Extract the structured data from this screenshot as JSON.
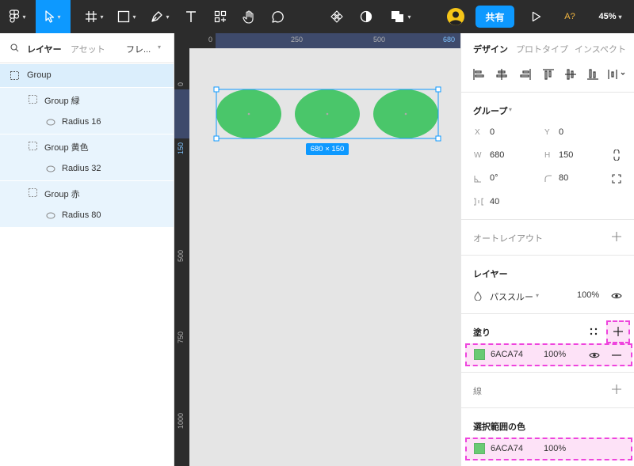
{
  "toolbar": {
    "share_label": "共有",
    "zoom_label": "45%",
    "font_check_label": "A?"
  },
  "left_panel": {
    "tabs": {
      "layers": "レイヤー",
      "assets": "アセット",
      "frame": "フレ..."
    },
    "layers": [
      {
        "label": "Group"
      },
      {
        "label": "Group 緑"
      },
      {
        "label": "Radius 16"
      },
      {
        "label": "Group 黄色"
      },
      {
        "label": "Radius 32"
      },
      {
        "label": "Group 赤"
      },
      {
        "label": "Radius 80"
      }
    ]
  },
  "ruler": {
    "top_ticks": [
      "0",
      "250",
      "500",
      "680"
    ],
    "left_ticks": [
      "0",
      "150",
      "500",
      "750",
      "1000"
    ]
  },
  "canvas": {
    "selection_size_label": "680 × 150",
    "ellipse_color": "#4AC66A",
    "selection_color": "#0d99ff"
  },
  "right_panel": {
    "tabs": {
      "design": "デザイン",
      "prototype": "プロトタイプ",
      "inspect": "インスペクト"
    },
    "group_title": "グループ",
    "x_label": "X",
    "x_value": "0",
    "y_label": "Y",
    "y_value": "0",
    "w_label": "W",
    "w_value": "680",
    "h_label": "H",
    "h_value": "150",
    "rotation_value": "0°",
    "radius_value": "80",
    "spacing_value": "40",
    "auto_layout": "オートレイアウト",
    "layer_title": "レイヤー",
    "blend_mode": "パススルー",
    "layer_opacity": "100%",
    "fill_title": "塗り",
    "fill_hex": "6ACA74",
    "fill_opacity": "100%",
    "stroke_title": "線",
    "selection_colors_title": "選択範囲の色",
    "selection_hex": "6ACA74",
    "selection_opacity": "100%",
    "swatch_color": "#6ACA74"
  }
}
